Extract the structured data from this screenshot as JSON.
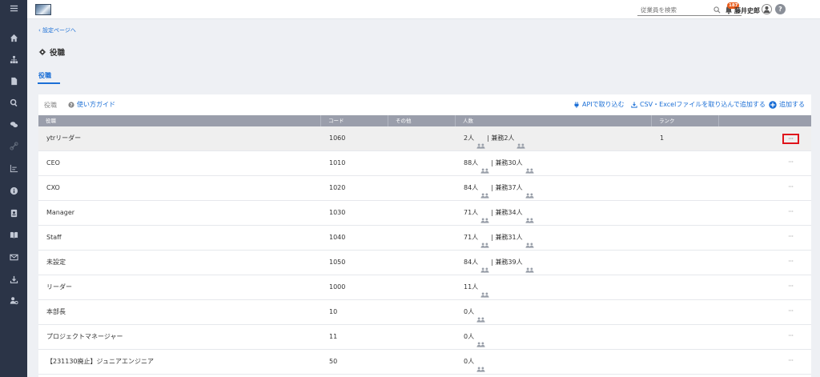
{
  "header": {
    "search_placeholder": "従業員を検索",
    "notification_count": "187",
    "user_name": "藤井史郎",
    "help_label": "?"
  },
  "breadcrumb": {
    "back_label": "設定ページへ"
  },
  "page": {
    "title": "役職"
  },
  "tabs": [
    {
      "label": "役職",
      "active": true
    }
  ],
  "toolbar": {
    "title": "役職",
    "guide_label": "使い方ガイド",
    "api_label": "APIで取り込む",
    "csv_label": "CSV・Excelファイルを取り込んで追加する",
    "add_label": "追加する"
  },
  "table": {
    "columns": [
      "役職",
      "コード",
      "その他",
      "人数",
      "ランク",
      ""
    ],
    "rows": [
      {
        "name": "ytrリーダー",
        "code": "1060",
        "count": "2人",
        "concurrent": "兼務2人",
        "rank": "1",
        "highlighted": true
      },
      {
        "name": "CEO",
        "code": "1010",
        "count": "88人",
        "concurrent": "兼務30人",
        "rank": ""
      },
      {
        "name": "CXO",
        "code": "1020",
        "count": "84人",
        "concurrent": "兼務37人",
        "rank": ""
      },
      {
        "name": "Manager",
        "code": "1030",
        "count": "71人",
        "concurrent": "兼務34人",
        "rank": ""
      },
      {
        "name": "Staff",
        "code": "1040",
        "count": "71人",
        "concurrent": "兼務31人",
        "rank": ""
      },
      {
        "name": "未設定",
        "code": "1050",
        "count": "84人",
        "concurrent": "兼務39人",
        "rank": ""
      },
      {
        "name": "リーダー",
        "code": "1000",
        "count": "11人",
        "concurrent": "",
        "rank": ""
      },
      {
        "name": "本部長",
        "code": "10",
        "count": "0人",
        "concurrent": "",
        "rank": ""
      },
      {
        "name": "プロジェクトマネージャー",
        "code": "11",
        "count": "0人",
        "concurrent": "",
        "rank": ""
      },
      {
        "name": "【231130廃止】ジュニアエンジニア",
        "code": "50",
        "count": "0人",
        "concurrent": "",
        "rank": ""
      }
    ],
    "more_label": "···"
  },
  "colors": {
    "sidebar": "#2b3447",
    "accent": "#1b6fd6",
    "table_header": "#9a9eab",
    "highlight_box": "#e0141b",
    "badge": "#e85b1a"
  },
  "sidebar_icons": [
    "menu-icon",
    "home-icon",
    "org-chart-icon",
    "document-icon",
    "search-icon",
    "chat-icon",
    "link-icon",
    "chart-icon",
    "info-icon",
    "profile-icon",
    "book-icon",
    "mail-icon",
    "download-icon",
    "user-settings-icon"
  ]
}
